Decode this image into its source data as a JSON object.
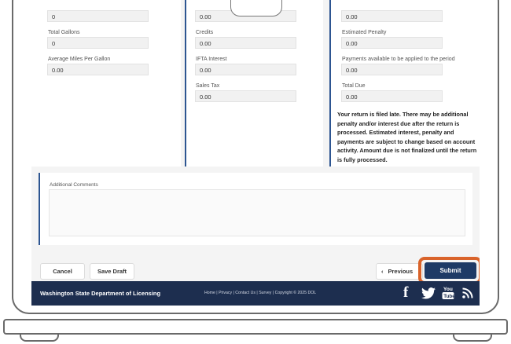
{
  "col1": {
    "top_value": "0",
    "total_gallons_label": "Total Gallons",
    "total_gallons_value": "0",
    "avg_mpg_label": "Average Miles Per Gallon",
    "avg_mpg_value": "0.00"
  },
  "col2": {
    "top_value": "0.00",
    "credits_label": "Credits",
    "credits_value": "0.00",
    "ifta_interest_label": "IFTA Interest",
    "ifta_interest_value": "0.00",
    "sales_tax_label": "Sales Tax",
    "sales_tax_value": "0.00"
  },
  "col3": {
    "top_value": "0.00",
    "estimated_penalty_label": "Estimated Penalty",
    "estimated_penalty_value": "0.00",
    "payments_label": "Payments available to be applied to the period",
    "payments_value": "0.00",
    "total_due_label": "Total Due",
    "total_due_value": "0.00",
    "late_notice": "Your return is filed late. There may be additional penalty and/or interest due after the return is processed. Estimated interest, penalty and payments are subject to change based on account activity. Amount due is not finalized until the return is fully processed."
  },
  "comments": {
    "label": "Additional Comments",
    "value": ""
  },
  "actions": {
    "cancel": "Cancel",
    "save_draft": "Save Draft",
    "previous_glyph": "‹",
    "previous": "Previous",
    "submit": "Submit"
  },
  "footer": {
    "org": "Washington State Department of Licensing",
    "links": "Home | Privacy | Contact Us | Survey | Copyright © 2025 DOL",
    "icons": [
      "facebook-icon",
      "twitter-icon",
      "youtube-icon",
      "rss-icon"
    ]
  },
  "colors": {
    "accent": "#2d5591",
    "footer_bg": "#1d2e4f",
    "submit_bg": "#1e3a66",
    "highlight": "#d9632a"
  }
}
